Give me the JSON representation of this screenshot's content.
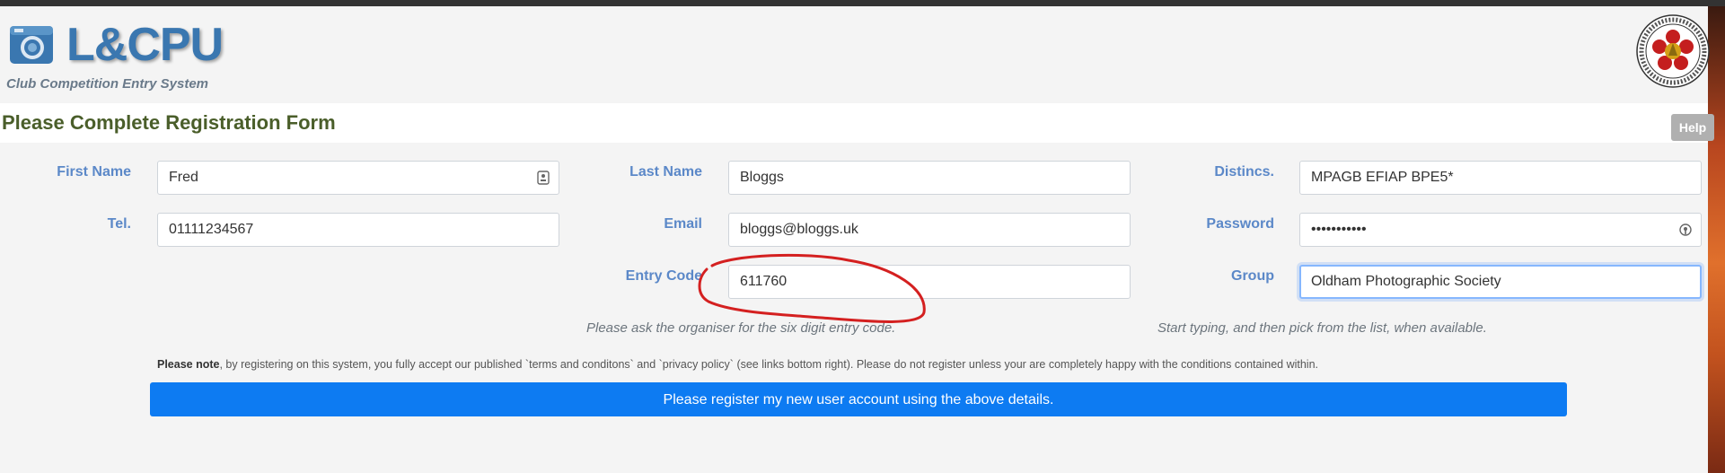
{
  "header": {
    "logo_text": "L&CPU",
    "tagline": "Club Competition Entry System",
    "seal_icon": "lancashire-cheshire-photographic-union-seal"
  },
  "page": {
    "title": "Please Complete Registration Form",
    "help_label": "Help"
  },
  "form": {
    "first_name": {
      "label": "First Name",
      "value": "Fred"
    },
    "last_name": {
      "label": "Last Name",
      "value": "Bloggs"
    },
    "distincs": {
      "label": "Distincs.",
      "value": "MPAGB EFIAP BPE5*"
    },
    "tel": {
      "label": "Tel.",
      "value": "01111234567"
    },
    "email": {
      "label": "Email",
      "value": "bloggs@bloggs.uk"
    },
    "password": {
      "label": "Password",
      "value": "•••••••••••"
    },
    "entry_code": {
      "label": "Entry Code",
      "value": "611760",
      "hint": "Please ask the organiser for the six digit entry code."
    },
    "group": {
      "label": "Group",
      "value": "Oldham Photographic Society",
      "hint": "Start typing, and then pick from the list, when available."
    }
  },
  "note": {
    "bold": "Please note",
    "text": ", by registering on this system, you fully accept our published `terms and conditons` and `privacy policy` (see links bottom right). Please do not register unless your are completely happy with the conditions contained within."
  },
  "submit_label": "Please register my new user account using the above details.",
  "colors": {
    "accent_blue": "#0d7bf2",
    "label_blue": "#5b88c8",
    "title_green": "#4a5e2a",
    "annotation_red": "#d42020"
  }
}
